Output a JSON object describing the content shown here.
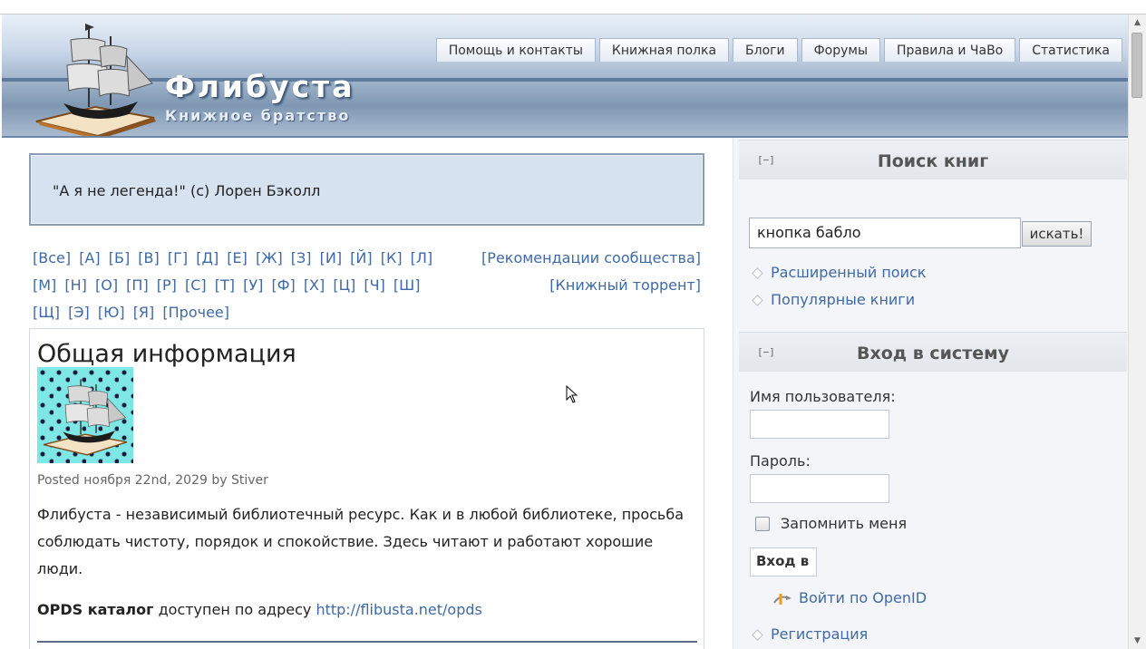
{
  "header": {
    "site_title": "Флибуста",
    "site_subtitle": "Книжное братство",
    "nav": [
      "Помощь и контакты",
      "Книжная полка",
      "Блоги",
      "Форумы",
      "Правила и ЧаВо",
      "Статистика"
    ]
  },
  "quote": "\"А я не легенда!\" (с) Лорен Бэколл",
  "alphabet": [
    "[Все]",
    "[А]",
    "[Б]",
    "[В]",
    "[Г]",
    "[Д]",
    "[Е]",
    "[Ж]",
    "[З]",
    "[И]",
    "[Й]",
    "[К]",
    "[Л]",
    "[М]",
    "[Н]",
    "[О]",
    "[П]",
    "[Р]",
    "[С]",
    "[Т]",
    "[У]",
    "[Ф]",
    "[Х]",
    "[Ц]",
    "[Ч]",
    "[Ш]",
    "[Щ]",
    "[Э]",
    "[Ю]",
    "[Я]",
    "[Прочее]"
  ],
  "extra_links": {
    "recommendations": "[Рекомендации сообщества]",
    "torrent": "[Книжный торрент]"
  },
  "content": {
    "title": "Общая информация",
    "posted": "Posted ноября 22nd, 2029 by Stiver",
    "body": "Флибуста - независимый библиотечный ресурс. Как и в любой библиотеке, просьба соблюдать чистоту, порядок и спокойствие. Здесь читают и работают хорошие люди.",
    "opds_label": "OPDS каталог",
    "opds_text": " доступен по адресу ",
    "opds_url": "http://flibusta.net/opds"
  },
  "sidebar": {
    "collapse_label": "[−]",
    "search": {
      "title": "Поиск книг",
      "input_value": "кнопка бабло",
      "button": "искать!",
      "advanced": "Расширенный поиск",
      "popular": "Популярные книги"
    },
    "login": {
      "title": "Вход в систему",
      "username_label": "Имя пользователя:",
      "password_label": "Пароль:",
      "remember": "Запомнить меня",
      "button": "Вход в",
      "openid": "Войти по OpenID",
      "register": "Регистрация"
    }
  },
  "colors": {
    "link": "#3f6aa5",
    "header_dark": "#6c86a5",
    "quote_bg": "#d7e2f1"
  }
}
